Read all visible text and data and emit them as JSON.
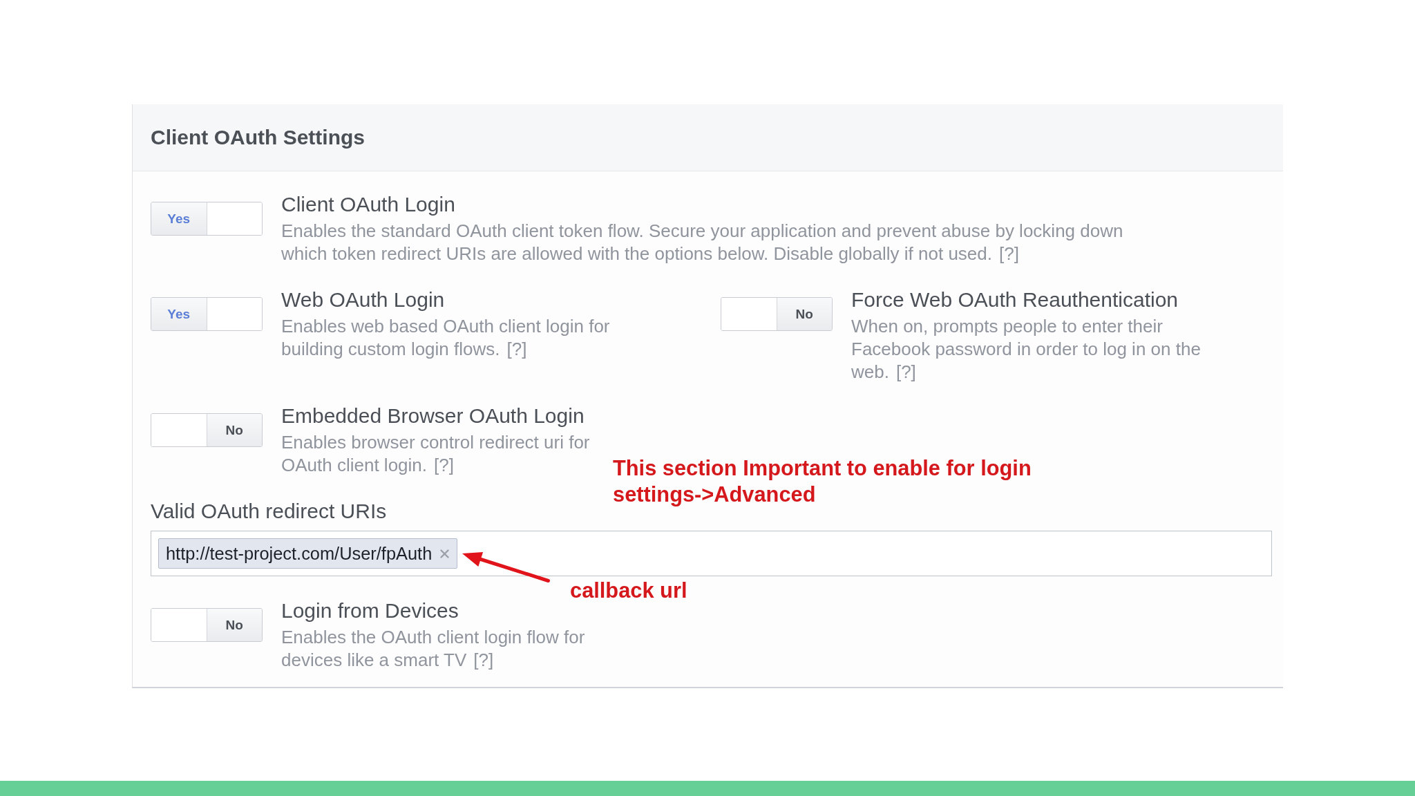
{
  "panel": {
    "title": "Client OAuth Settings"
  },
  "fields": [
    {
      "kind": "wide_toggles",
      "items": [
        {
          "title": "Client OAuth Login",
          "description": "Enables the standard OAuth client token flow. Secure your application and prevent abuse by locking down which token redirect URIs are allowed with the options below. Disable globally if not used.",
          "help": "[?]",
          "toggle": {
            "on": true,
            "label": "Yes"
          }
        }
      ]
    },
    {
      "kind": "toggle_grid",
      "items": [
        {
          "title": "Web OAuth Login",
          "description": "Enables web based OAuth client login for building custom login flows.",
          "help": "[?]",
          "toggle": {
            "on": true,
            "label": "Yes"
          }
        },
        {
          "title": "Force Web OAuth Reauthentication",
          "description": "When on, prompts people to enter their Facebook password in order to log in on the web.",
          "help": "[?]",
          "toggle": {
            "on": false,
            "label": "No"
          }
        },
        {
          "title": "Embedded Browser OAuth Login",
          "description": "Enables browser control redirect uri for OAuth client login.",
          "help": "[?]",
          "toggle": {
            "on": false,
            "label": "No"
          }
        }
      ]
    },
    {
      "kind": "tag_input",
      "label": "Valid OAuth redirect URIs",
      "tags": [
        {
          "text": "http://test-project.com/User/fpAuth"
        }
      ]
    },
    {
      "kind": "toggle_grid",
      "items": [
        {
          "title": "Login from Devices",
          "description": "Enables the OAuth client login flow for devices like a smart TV",
          "help": "[?]",
          "toggle": {
            "on": false,
            "label": "No"
          }
        }
      ]
    }
  ],
  "annotations": [
    {
      "kind": "note",
      "text": "This section Important to enable for login settings->Advanced"
    },
    {
      "kind": "callout",
      "text": "callback url"
    }
  ]
}
